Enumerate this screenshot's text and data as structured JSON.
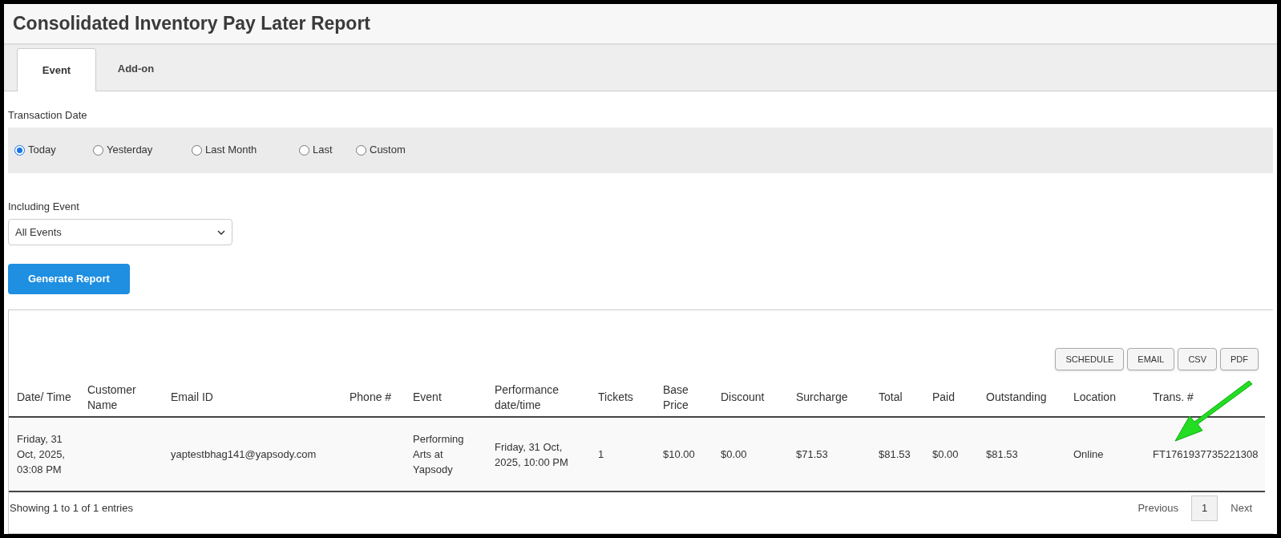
{
  "page_title": "Consolidated Inventory Pay Later Report",
  "tabs": [
    {
      "label": "Event",
      "selected": true
    },
    {
      "label": "Add-on",
      "selected": false
    }
  ],
  "transaction_date": {
    "label": "Transaction Date",
    "options": [
      {
        "label": "Today",
        "selected": true
      },
      {
        "label": "Yesterday",
        "selected": false
      },
      {
        "label": "Last Month",
        "selected": false
      },
      {
        "label": "Last",
        "selected": false
      },
      {
        "label": "Custom",
        "selected": false
      }
    ]
  },
  "including_event": {
    "label": "Including Event",
    "value": "All Events"
  },
  "generate_button": "Generate Report",
  "export_buttons": [
    "SCHEDULE",
    "EMAIL",
    "CSV",
    "PDF"
  ],
  "table": {
    "columns": [
      "Date/ Time",
      "Customer Name",
      "Email ID",
      "Phone #",
      "Event",
      "Performance date/time",
      "Tickets",
      "Base Price",
      "Discount",
      "Surcharge",
      "Total",
      "Paid",
      "Outstanding",
      "Location",
      "Trans. #"
    ],
    "rows": [
      {
        "cells": [
          "Friday, 31 Oct, 2025, 03:08 PM",
          null,
          "yaptestbhag141@yapsody.com",
          null,
          "Performing Arts at Yapsody",
          "Friday, 31 Oct, 2025, 10:00 PM",
          "1",
          "$10.00",
          "$0.00",
          "$71.53",
          "$81.53",
          "$0.00",
          "$81.53",
          "Online",
          "FT1761937735221308"
        ]
      }
    ]
  },
  "footer": {
    "info": "Showing 1 to 1 of 1 entries",
    "pagination": [
      {
        "label": "Previous",
        "selected": false
      },
      {
        "label": "1",
        "selected": true
      },
      {
        "label": "Next",
        "selected": false
      }
    ]
  }
}
